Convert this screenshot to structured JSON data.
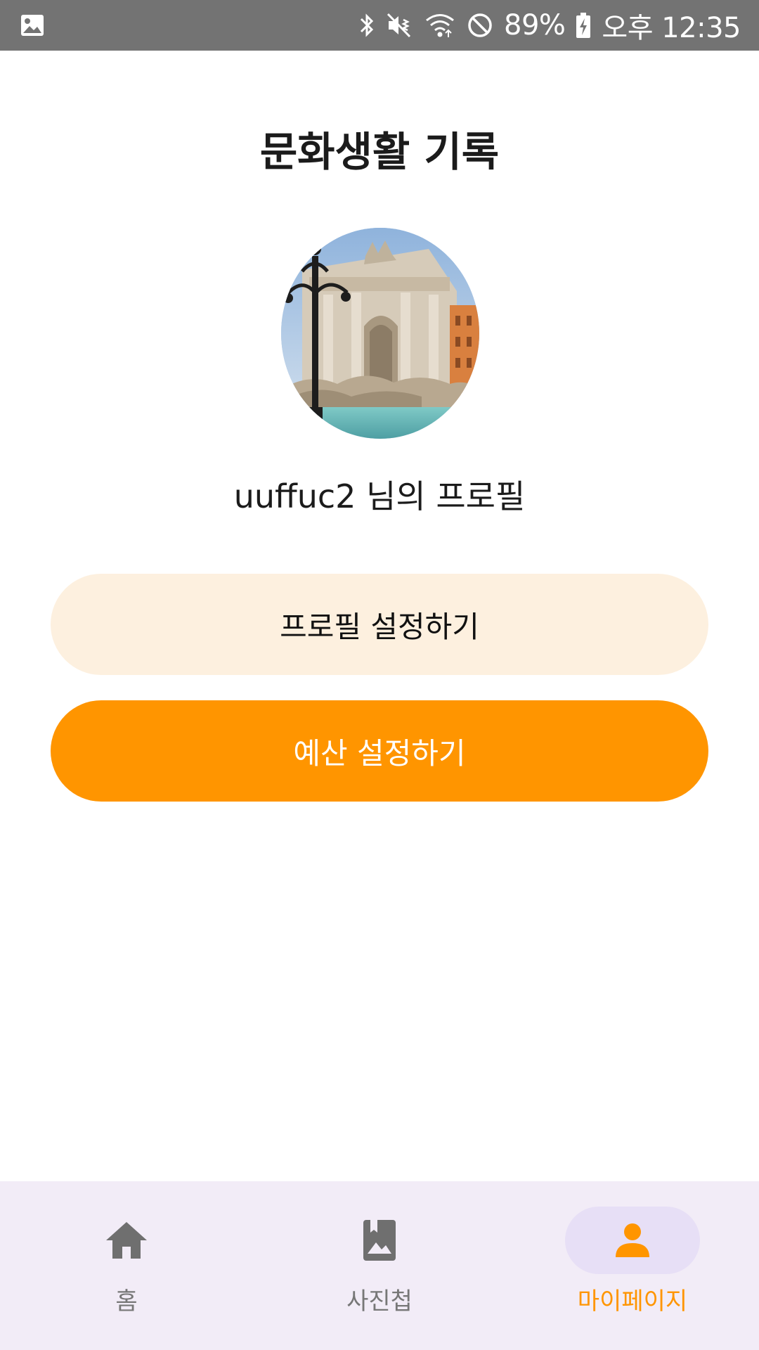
{
  "status_bar": {
    "battery": "89%",
    "time": "오후 12:35",
    "icons": [
      "gallery-icon",
      "bluetooth-icon",
      "vibrate-mute-icon",
      "wifi-icon",
      "do-not-disturb-icon",
      "battery-charging-icon"
    ]
  },
  "page": {
    "title": "문화생활 기록"
  },
  "profile": {
    "name_label": "uuffuc2 님의 프로필",
    "avatar": "fountain-photo"
  },
  "buttons": {
    "profile_settings": "프로필 설정하기",
    "budget_settings": "예산 설정하기"
  },
  "nav": {
    "items": [
      {
        "label": "홈",
        "icon": "home-icon",
        "active": false
      },
      {
        "label": "사진첩",
        "icon": "photo-album-icon",
        "active": false
      },
      {
        "label": "마이페이지",
        "icon": "person-icon",
        "active": true
      }
    ]
  },
  "colors": {
    "accent": "#ff9500",
    "profile_button_bg": "#fdf0df",
    "nav_bg": "#f2ecf7",
    "nav_active_pill": "#e7dff6",
    "status_bar": "#737373"
  }
}
